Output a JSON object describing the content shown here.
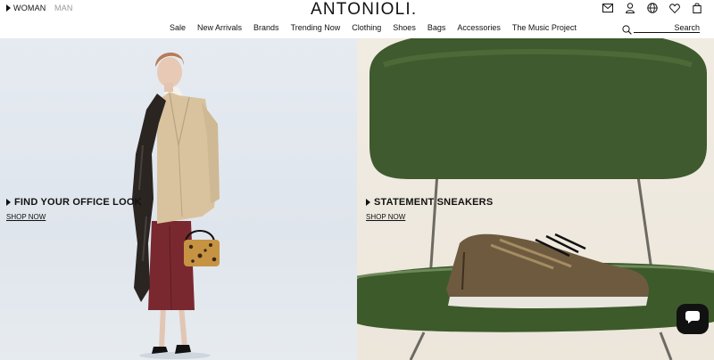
{
  "header": {
    "gender_tabs": [
      {
        "label": "WOMAN",
        "active": true
      },
      {
        "label": "MAN",
        "active": false
      }
    ],
    "logo": "ANTONIOLI.",
    "icons": [
      "mail-icon",
      "user-icon",
      "globe-icon",
      "wishlist-icon",
      "bag-icon"
    ]
  },
  "nav": {
    "items": [
      "Sale",
      "New Arrivals",
      "Brands",
      "Trending Now",
      "Clothing",
      "Shoes",
      "Bags",
      "Accessories",
      "The Music Project"
    ],
    "search": {
      "label": "Search",
      "icon": "search-icon"
    }
  },
  "heroes": [
    {
      "title": "FIND YOUR OFFICE LOOK",
      "link": "SHOP NOW"
    },
    {
      "title": "STATEMENT SNEAKERS",
      "link": "SHOP NOW"
    }
  ],
  "chat": {
    "icon": "chat-icon"
  },
  "colors": {
    "text": "#111111",
    "inactive": "#999999",
    "left_bg": "#e3e9ef",
    "right_bg": "#eee8dd",
    "chair": "#3f5a2e"
  }
}
